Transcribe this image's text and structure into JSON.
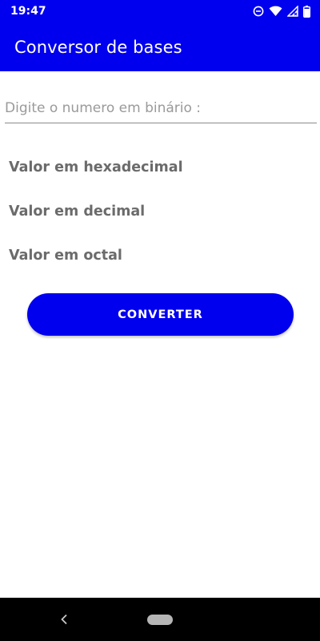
{
  "status_bar": {
    "time": "19:47",
    "icons": [
      "do-not-disturb-icon",
      "wifi-icon",
      "signal-icon",
      "battery-icon"
    ]
  },
  "app_bar": {
    "title": "Conversor de bases"
  },
  "form": {
    "binary_input": {
      "placeholder": "Digite o numero em binário :",
      "value": ""
    },
    "hex_label": "Valor em hexadecimal",
    "decimal_label": "Valor em decimal",
    "octal_label": "Valor em octal",
    "convert_button": "CONVERTER"
  },
  "nav_bar": {
    "icons": [
      "back-icon",
      "home-pill-icon"
    ]
  },
  "colors": {
    "accent": "#0000ee",
    "label_text": "#6b6b6b",
    "placeholder_text": "#9a9a9a"
  }
}
